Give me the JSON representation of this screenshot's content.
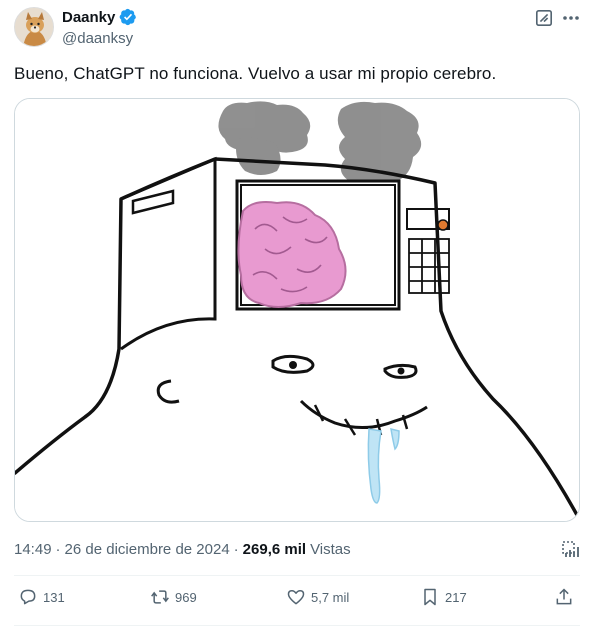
{
  "author": {
    "display_name": "Daanky",
    "handle": "@daanksy",
    "verified": true,
    "badge_color": "#1d9bf0"
  },
  "tweet": {
    "text": "Bueno, ChatGPT no funciona. Vuelvo a usar mi propio cerebro.",
    "time": "14:49",
    "separator1": "·",
    "date": "26 de diciembre de 2024",
    "separator2": "·",
    "views_count": "269,6 mil",
    "views_label": "Vistas"
  },
  "actions": {
    "replies": "131",
    "reposts": "969",
    "likes": "5,7 mil",
    "bookmarks": "217"
  },
  "icons": [
    "grok-icon",
    "more-icon",
    "verified-icon",
    "analytics-icon",
    "reply-icon",
    "repost-icon",
    "like-icon",
    "bookmark-icon",
    "share-icon"
  ]
}
